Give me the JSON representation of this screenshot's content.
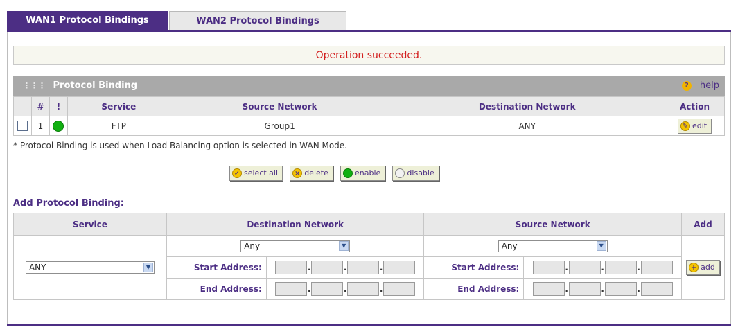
{
  "tabs": [
    {
      "label": "WAN1 Protocol Bindings",
      "active": true
    },
    {
      "label": "WAN2 Protocol Bindings",
      "active": false
    }
  ],
  "status_message": "Operation succeeded.",
  "section": {
    "title": "Protocol Binding",
    "help_label": "help"
  },
  "binding_table": {
    "headers": [
      "#",
      "!",
      "Service",
      "Source Network",
      "Destination Network",
      "Action"
    ],
    "rows": [
      {
        "number": "1",
        "status": "enabled",
        "service": "FTP",
        "source_network": "Group1",
        "destination_network": "ANY",
        "action_label": "edit"
      }
    ]
  },
  "note": "* Protocol Binding is used when Load Balancing option is selected in WAN Mode.",
  "buttons": {
    "select_all": "select all",
    "delete": "delete",
    "enable": "enable",
    "disable": "disable"
  },
  "add_section": {
    "title": "Add Protocol Binding:",
    "headers": {
      "service": "Service",
      "destination": "Destination Network",
      "source": "Source Network",
      "add": "Add"
    },
    "service_value": "ANY",
    "destination_select": "Any",
    "source_select": "Any",
    "start_address_label": "Start Address:",
    "end_address_label": "End Address:",
    "add_button": "add"
  },
  "colors": {
    "brand": "#4c2e84",
    "success_dot": "#11b011",
    "message": "#d32020"
  }
}
